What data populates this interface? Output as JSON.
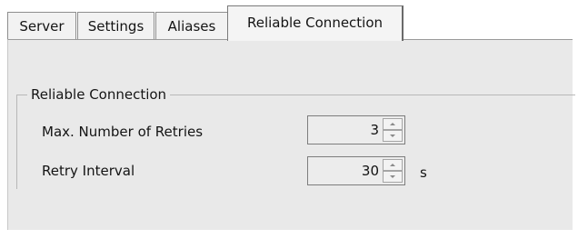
{
  "tabs": [
    {
      "label": "Server",
      "active": false
    },
    {
      "label": "Settings",
      "active": false
    },
    {
      "label": "Aliases",
      "active": false
    },
    {
      "label": "Reliable Connection",
      "active": true
    }
  ],
  "group": {
    "title": "Reliable Connection",
    "fields": [
      {
        "label": "Max. Number of Retries",
        "value": "3",
        "unit": ""
      },
      {
        "label": "Retry Interval",
        "value": "30",
        "unit": "s"
      }
    ]
  },
  "icons": {
    "spin_up": "spin-up-arrow-icon",
    "spin_down": "spin-down-arrow-icon"
  }
}
